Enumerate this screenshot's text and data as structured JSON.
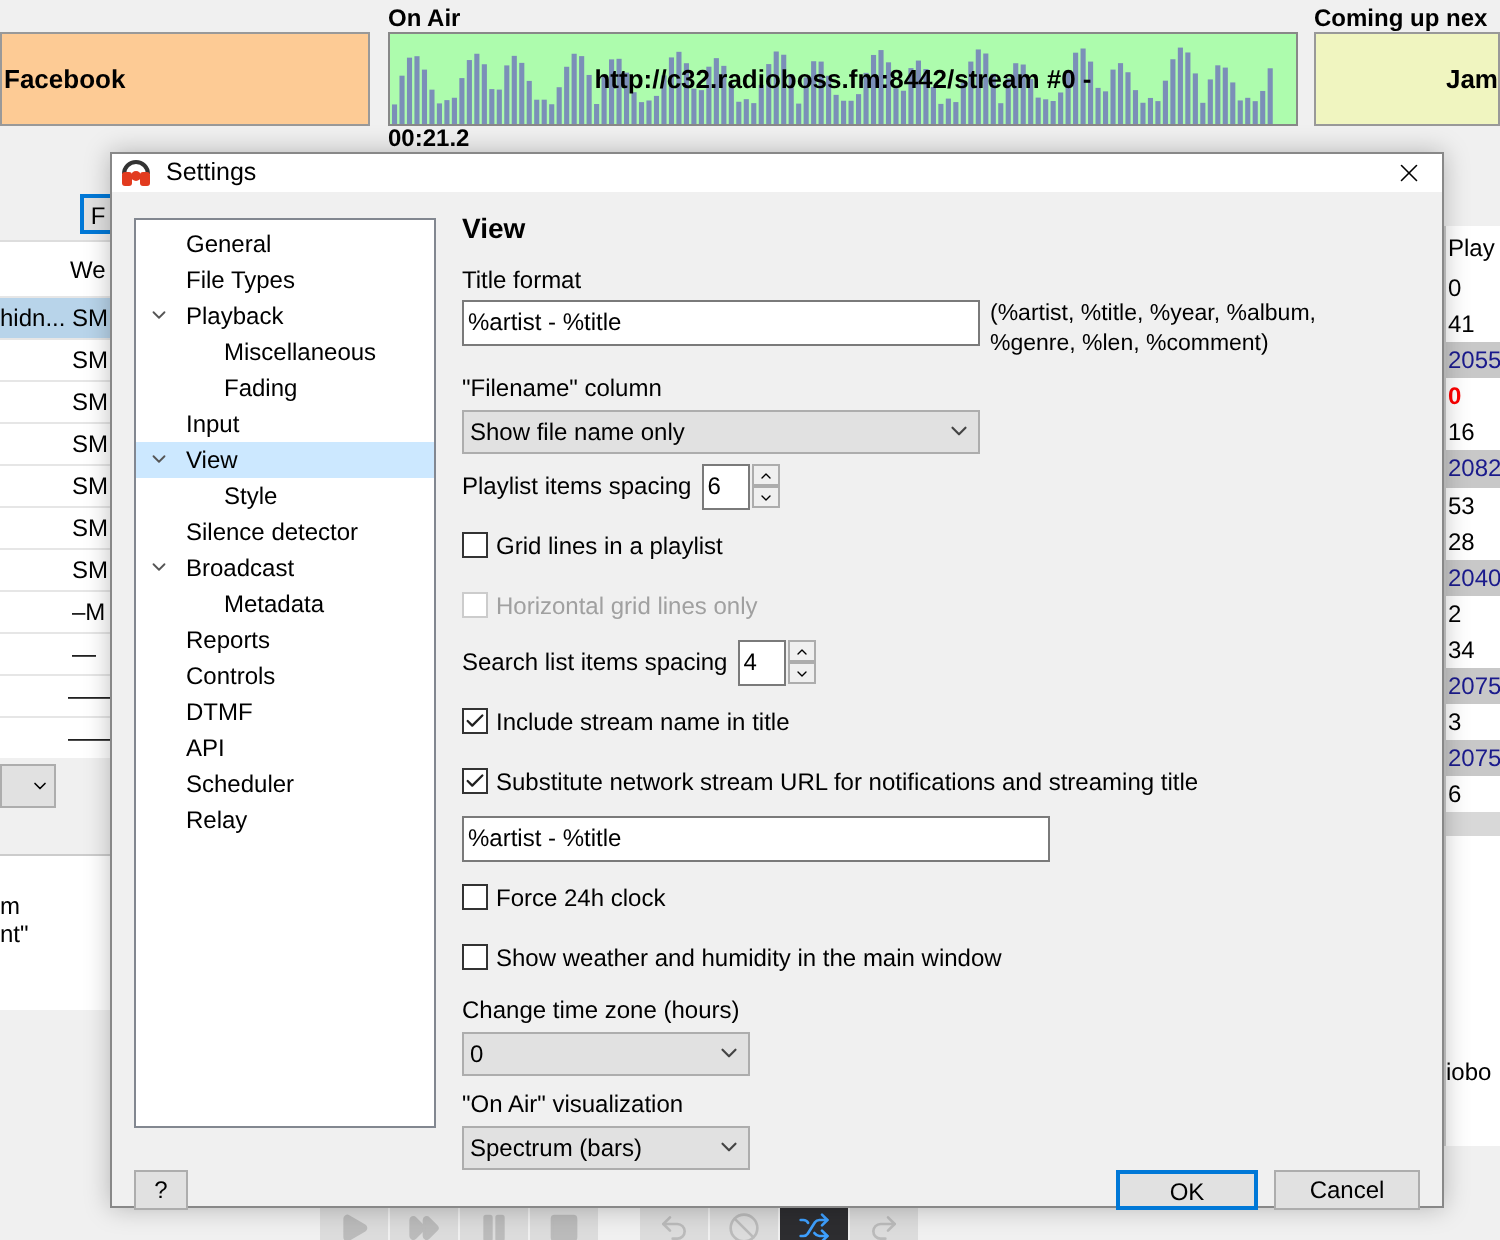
{
  "previous": {
    "text": "Facebook"
  },
  "on_air": {
    "heading": "On Air",
    "stream": "http://c32.radioboss.fm:8442/stream #0 -",
    "time": "00:21.2"
  },
  "coming_up": {
    "heading": "Coming up nex",
    "text": "Jam"
  },
  "playlist": {
    "button": "F",
    "column_header": "We",
    "rows": [
      {
        "cell_1": "hidn...",
        "cell_2": "SM",
        "selected": true
      },
      {
        "cell_1": "",
        "cell_2": "SM",
        "selected": false
      },
      {
        "cell_1": "",
        "cell_2": "SM",
        "selected": false
      },
      {
        "cell_1": "",
        "cell_2": "SM",
        "selected": false
      },
      {
        "cell_1": "",
        "cell_2": "SM",
        "selected": false
      },
      {
        "cell_1": "",
        "cell_2": "SM",
        "selected": false
      },
      {
        "cell_1": "",
        "cell_2": "SM",
        "selected": false
      },
      {
        "cell_1": "",
        "cell_2": "–M",
        "selected": false
      },
      {
        "cell_1": "",
        "cell_2": "—",
        "selected": false
      },
      {
        "cell_1": "",
        "cell_2": "——",
        "selected": false
      },
      {
        "cell_1": "",
        "cell_2": "——",
        "selected": false
      }
    ]
  },
  "log_lines": [
    "m",
    "nt\""
  ],
  "stats": {
    "header": "Play",
    "rows": [
      {
        "value": "0",
        "kind": "normal"
      },
      {
        "value": "41",
        "kind": "normal"
      },
      {
        "value": "2055",
        "kind": "highlight"
      },
      {
        "value": "0",
        "kind": "alert"
      },
      {
        "value": "16",
        "kind": "normal"
      },
      {
        "value": "2082",
        "kind": "highlight"
      },
      {
        "value": "53",
        "kind": "normal"
      },
      {
        "value": "28",
        "kind": "normal"
      },
      {
        "value": "2040",
        "kind": "highlight"
      },
      {
        "value": "2",
        "kind": "normal"
      },
      {
        "value": "34",
        "kind": "normal"
      },
      {
        "value": "2075",
        "kind": "highlight"
      },
      {
        "value": "3",
        "kind": "normal"
      },
      {
        "value": "2075",
        "kind": "highlight"
      },
      {
        "value": "6",
        "kind": "normal"
      }
    ],
    "footer": "iobo"
  },
  "toolbar": [
    {
      "kind": "play",
      "active": false
    },
    {
      "kind": "forward",
      "active": false
    },
    {
      "kind": "pause",
      "active": false
    },
    {
      "kind": "stop",
      "active": false
    },
    {
      "kind": "undo",
      "active": false
    },
    {
      "kind": "block",
      "active": false
    },
    {
      "kind": "shuffle",
      "active": true
    },
    {
      "kind": "redo",
      "active": false
    }
  ],
  "dialog": {
    "title": "Settings",
    "tree": [
      {
        "label": "General",
        "selected": false
      },
      {
        "label": "File Types",
        "selected": false
      },
      {
        "label": "Playback",
        "selected": false,
        "expanded": true,
        "children": [
          {
            "label": "Miscellaneous",
            "selected": false
          },
          {
            "label": "Fading",
            "selected": false
          }
        ]
      },
      {
        "label": "Input",
        "selected": false
      },
      {
        "label": "View",
        "selected": true,
        "expanded": true,
        "children": [
          {
            "label": "Style",
            "selected": false
          }
        ]
      },
      {
        "label": "Silence detector",
        "selected": false
      },
      {
        "label": "Broadcast",
        "selected": false,
        "expanded": true,
        "children": [
          {
            "label": "Metadata",
            "selected": false
          }
        ]
      },
      {
        "label": "Reports",
        "selected": false
      },
      {
        "label": "Controls",
        "selected": false
      },
      {
        "label": "DTMF",
        "selected": false
      },
      {
        "label": "API",
        "selected": false
      },
      {
        "label": "Scheduler",
        "selected": false
      },
      {
        "label": "Relay",
        "selected": false
      }
    ],
    "heading": "View",
    "rows": [
      {
        "kind": "text",
        "label": "Title format",
        "value": "%artist - %title",
        "hint": "(%artist, %title, %year, %album, %genre, %len, %comment)"
      },
      {
        "kind": "select",
        "label": "\"Filename\" column",
        "value": "Show file name only",
        "wide": true
      },
      {
        "kind": "spin",
        "label": "Playlist items spacing",
        "value": "6"
      },
      {
        "kind": "checkbox",
        "label": "Grid lines in a playlist",
        "checked": false,
        "disabled": false
      },
      {
        "kind": "checkbox",
        "label": "Horizontal grid lines only",
        "checked": false,
        "disabled": true
      },
      {
        "kind": "spin",
        "label": "Search list items spacing",
        "value": "4"
      },
      {
        "kind": "checkbox",
        "label": "Include stream name in title",
        "checked": true,
        "disabled": false
      },
      {
        "kind": "checkbox",
        "label": "Substitute network stream URL for notifications and streaming title",
        "checked": true,
        "disabled": false
      },
      {
        "kind": "input",
        "value": "%artist - %title"
      },
      {
        "kind": "checkbox",
        "label": "Force 24h clock",
        "checked": false,
        "disabled": false
      },
      {
        "kind": "checkbox",
        "label": "Show weather and humidity in the main window",
        "checked": false,
        "disabled": false
      },
      {
        "kind": "select",
        "label": "Change time zone (hours)",
        "value": "0",
        "wide": false
      },
      {
        "kind": "select",
        "label": "\"On Air\" visualization",
        "value": "Spectrum (bars)",
        "wide": false
      }
    ],
    "help": "?",
    "ok": "OK",
    "cancel": "Cancel"
  }
}
